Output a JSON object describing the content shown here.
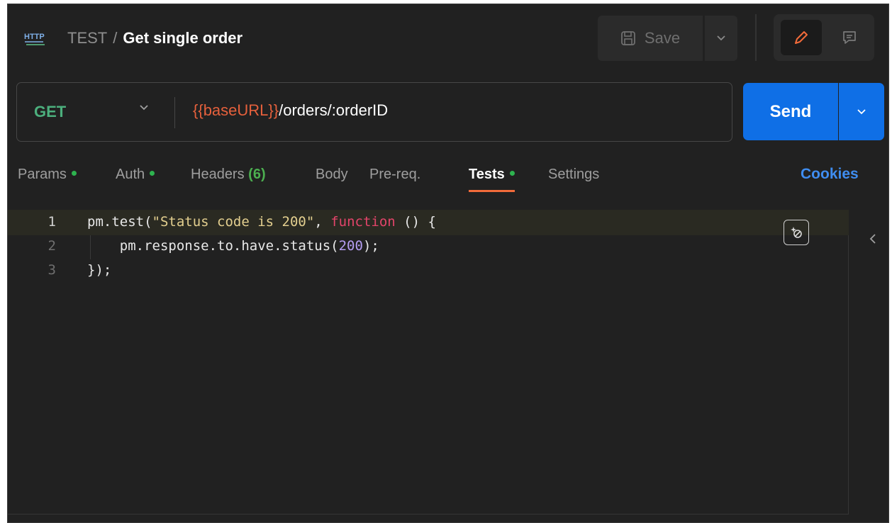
{
  "header": {
    "collection": "TEST",
    "separator": "/",
    "request_name": "Get single order",
    "save_label": "Save"
  },
  "request": {
    "method": "GET",
    "url_variable": "{{baseURL}}",
    "url_path": "/orders/:orderID",
    "send_label": "Send"
  },
  "tabs": [
    {
      "label": "Params",
      "dot": true
    },
    {
      "label": "Auth",
      "dot": true
    },
    {
      "label": "Headers",
      "count": "(6)"
    },
    {
      "label": "Body"
    },
    {
      "label": "Pre-req."
    },
    {
      "label": "Tests",
      "dot": true,
      "active": true
    },
    {
      "label": "Settings"
    }
  ],
  "cookies_label": "Cookies",
  "editor": {
    "line_numbers": [
      "1",
      "2",
      "3"
    ],
    "lines": {
      "l1_a": "pm.test(",
      "l1_str": "\"Status code is 200\"",
      "l1_b": ", ",
      "l1_kw": "function",
      "l1_c": " () {",
      "l2_a": "    pm.response.to.have.status(",
      "l2_num": "200",
      "l2_b": ");",
      "l3": "});"
    }
  },
  "colors": {
    "accent_send": "#0f6fe6",
    "method_get": "#4caf7d",
    "url_variable": "#e5603c",
    "active_tab_underline": "#f26b3a",
    "status_dot": "#2eb34f",
    "cookies_link": "#3f8df0"
  },
  "icons": [
    "http-icon",
    "save-icon",
    "chevron-down-icon",
    "pencil-icon",
    "comment-icon",
    "ai-assist-icon",
    "chevron-left-icon"
  ]
}
